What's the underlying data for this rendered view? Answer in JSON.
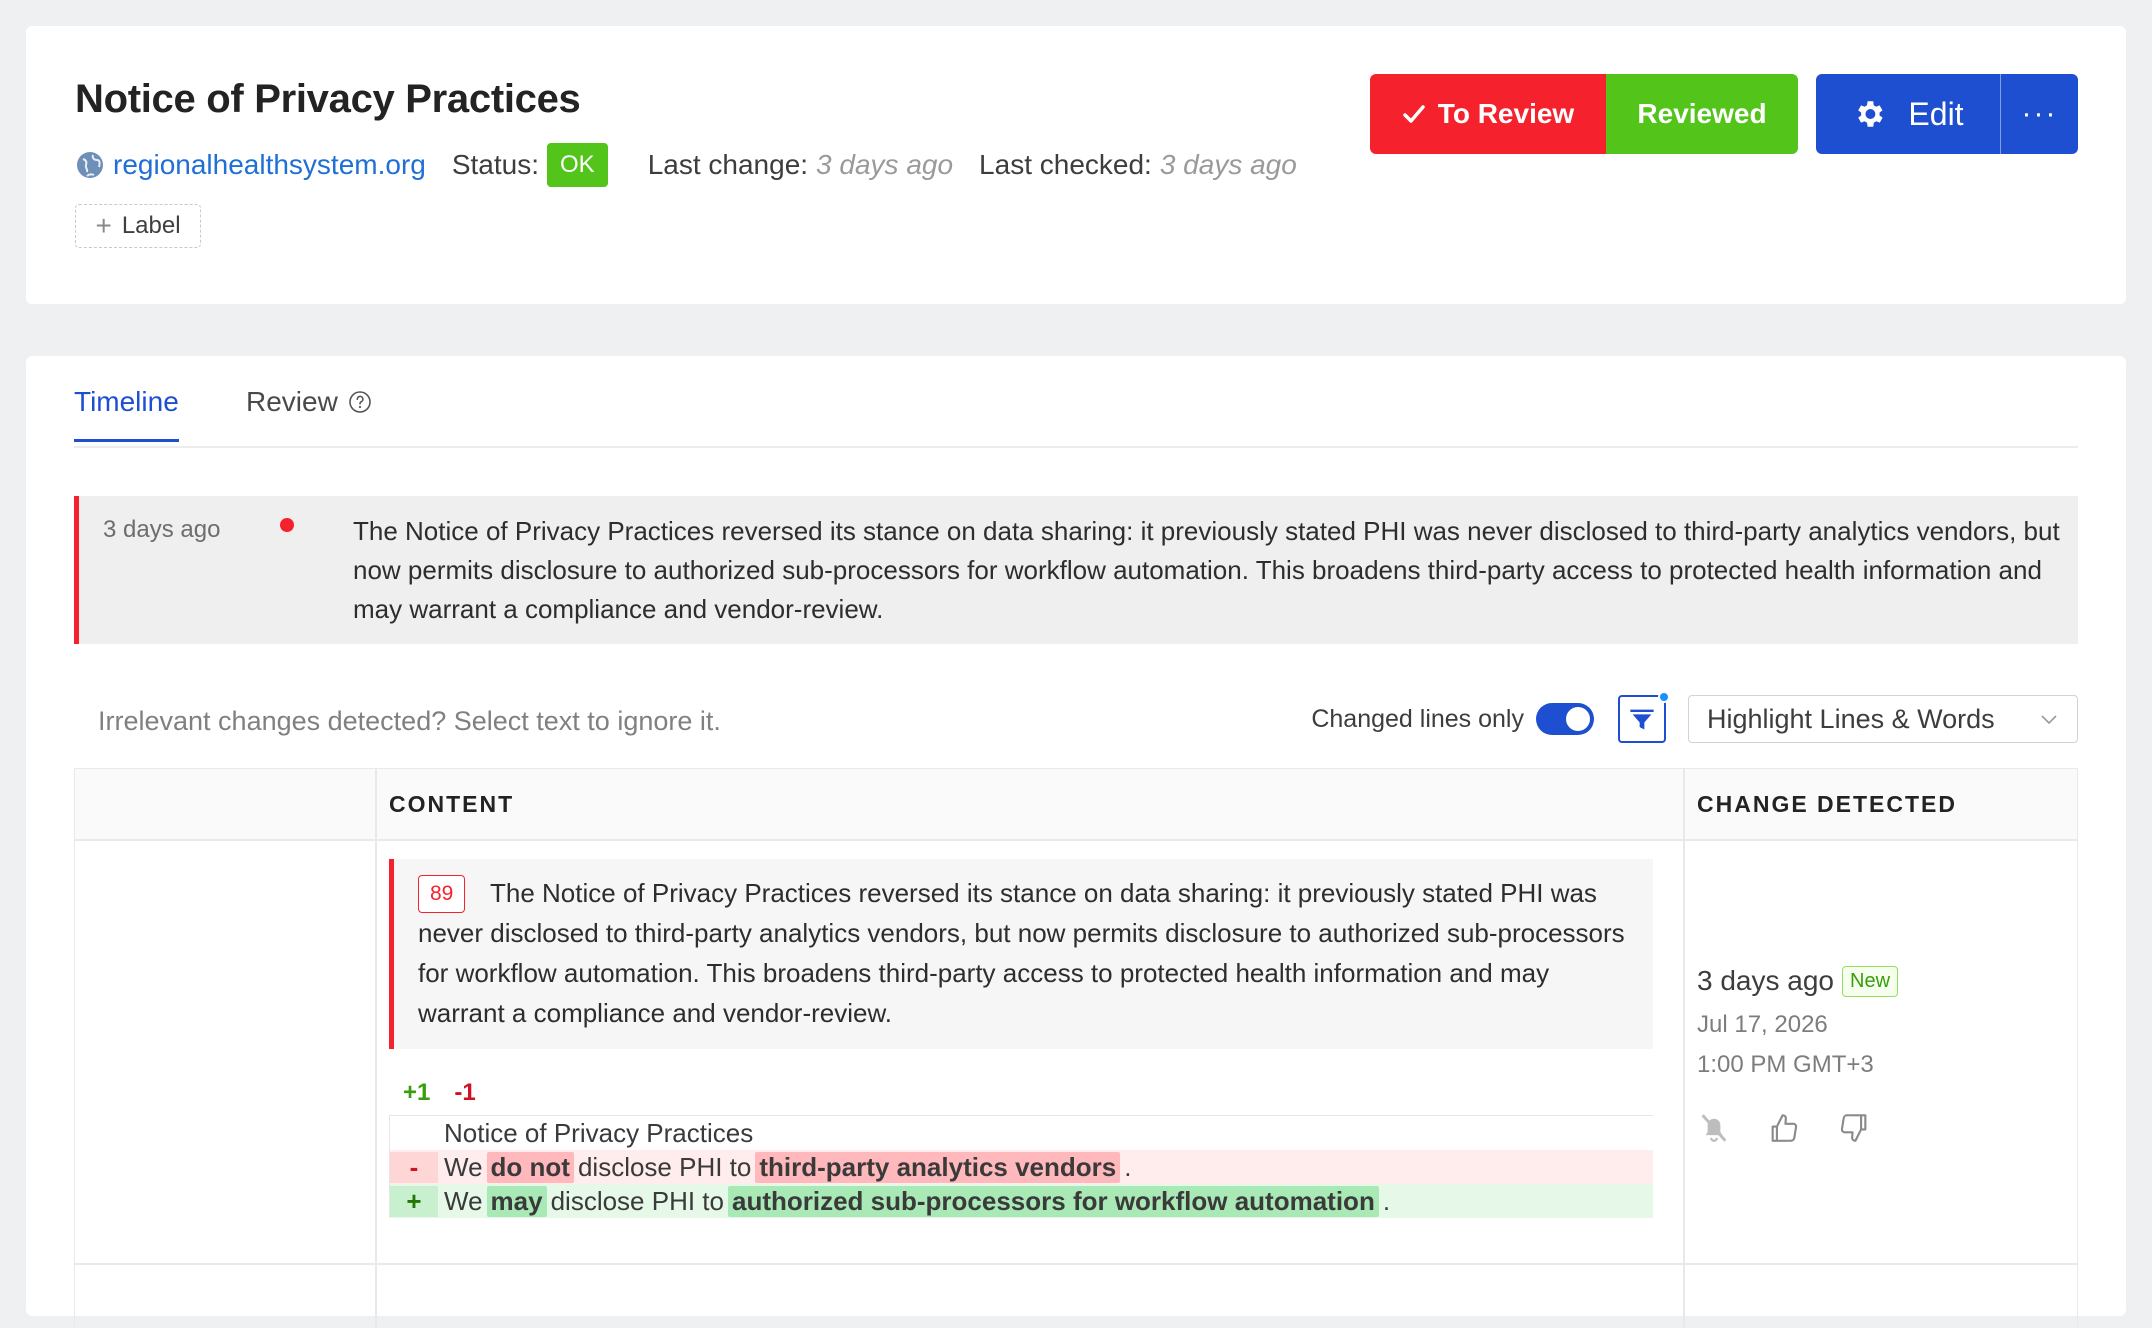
{
  "header": {
    "title": "Notice of Privacy Practices",
    "site": "regionalhealthsystem.org",
    "status_label": "Status:",
    "status_value": "OK",
    "last_change_label": "Last change:",
    "last_change_value": "3 days ago",
    "last_checked_label": "Last checked:",
    "last_checked_value": "3 days ago",
    "add_label": "Label",
    "to_review_label": "To Review",
    "reviewed_label": "Reviewed",
    "edit_label": "Edit",
    "more_label": "···"
  },
  "tabs": [
    {
      "label": "Timeline",
      "active": true
    },
    {
      "label": "Review",
      "active": false
    }
  ],
  "summary": {
    "time": "3 days ago",
    "text": "The Notice of Privacy Practices reversed its stance on data sharing: it previously stated PHI was never disclosed to third-party analytics vendors, but now permits disclosure to authorized sub-processors for workflow automation. This broadens third-party access to protected health information and may warrant a compliance and vendor-review."
  },
  "toolbar": {
    "hint": "Irrelevant changes detected? Select text to ignore it.",
    "toggle_label": "Changed lines only",
    "toggle_on": true,
    "highlight_mode": "Highlight Lines & Words"
  },
  "table": {
    "col_content": "CONTENT",
    "col_detected": "CHANGE DETECTED"
  },
  "change": {
    "number": "89",
    "text": "The Notice of Privacy Practices reversed its stance on data sharing: it previously stated PHI was never disclosed to third-party analytics vendors, but now permits disclosure to authorized sub-processors for workflow automation. This broadens third-party access to protected health information and may warrant a compliance and vendor-review.",
    "added": "+1",
    "removed": "-1",
    "diff": {
      "context": "Notice of Privacy Practices",
      "del_sign": "-",
      "del_w1": "We",
      "del_h1": "do not",
      "del_w2": "disclose PHI to",
      "del_h2": "third-party analytics vendors",
      "del_end": ".",
      "add_sign": "+",
      "add_w1": "We",
      "add_h1": "may",
      "add_w2": "disclose PHI to",
      "add_h2": "authorized sub-processors for workflow automation",
      "add_end": "."
    },
    "detected_rel": "3 days ago",
    "new_badge": "New",
    "detected_date": "Jul 17, 2026",
    "detected_time": "1:00 PM GMT+3"
  },
  "colors": {
    "accent": "#1f4fd1",
    "danger": "#f5222d",
    "success": "#52c41a",
    "link": "#1f6fd6"
  },
  "icons": [
    "globe-icon",
    "plus-icon",
    "check-icon",
    "gear-icon",
    "help-icon",
    "filter-icon",
    "chevron-down-icon",
    "bell-off-icon",
    "thumbs-up-icon",
    "thumbs-down-icon"
  ]
}
